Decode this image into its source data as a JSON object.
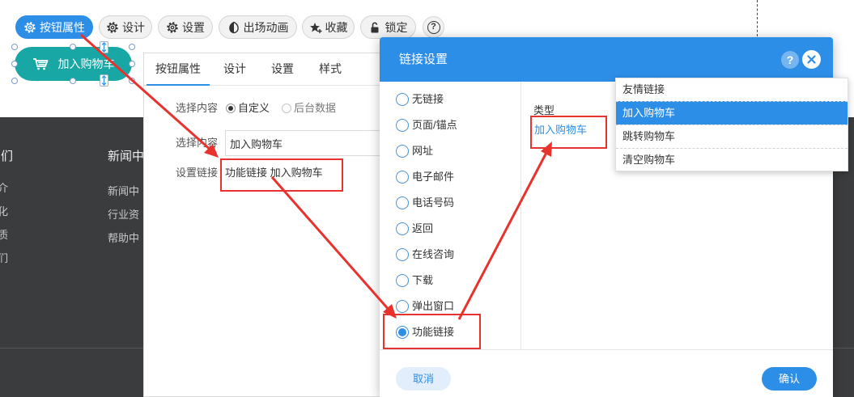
{
  "toolbar": {
    "items": [
      {
        "label": "按钮属性",
        "icon": "gear-icon",
        "active": true
      },
      {
        "label": "设计",
        "icon": "gear-icon"
      },
      {
        "label": "设置",
        "icon": "gear-icon"
      },
      {
        "label": "出场动画",
        "icon": "animation-icon"
      },
      {
        "label": "收藏",
        "icon": "star-icon"
      },
      {
        "label": "锁定",
        "icon": "lock-icon"
      }
    ],
    "help_label": "?"
  },
  "canvas": {
    "selected_button": {
      "label": "加入购物车",
      "icon": "cart-icon"
    },
    "footer": {
      "col1": {
        "heading": "们",
        "items": [
          "介",
          "化",
          "质",
          "们"
        ]
      },
      "col2": {
        "heading": "新闻中",
        "items": [
          "新闻中",
          "行业资",
          "帮助中"
        ]
      }
    }
  },
  "panel": {
    "tabs": [
      {
        "label": "按钮属性",
        "active": true
      },
      {
        "label": "设计"
      },
      {
        "label": "设置"
      },
      {
        "label": "样式"
      }
    ],
    "content_source": {
      "label": "选择内容",
      "options": [
        {
          "label": "自定义",
          "checked": true
        },
        {
          "label": "后台数据"
        }
      ]
    },
    "content": {
      "label": "选择内容",
      "value": "加入购物车"
    },
    "link": {
      "label": "设置链接",
      "value": "功能链接 加入购物车"
    }
  },
  "dialog": {
    "title": "链接设置",
    "help_label": "?",
    "close_icon": "close-icon",
    "link_types": [
      {
        "label": "无链接"
      },
      {
        "label": "页面/锚点"
      },
      {
        "label": "网址"
      },
      {
        "label": "电子邮件"
      },
      {
        "label": "电话号码"
      },
      {
        "label": "返回"
      },
      {
        "label": "在线咨询"
      },
      {
        "label": "下载"
      },
      {
        "label": "弹出窗口"
      },
      {
        "label": "功能链接",
        "checked": true
      }
    ],
    "type_label": "类型",
    "type_value": "加入购物车",
    "dropdown": {
      "options": [
        {
          "label": "友情链接"
        },
        {
          "label": "加入购物车",
          "selected": true
        },
        {
          "label": "跳转购物车"
        },
        {
          "label": "清空购物车"
        }
      ]
    },
    "cancel_label": "取消",
    "confirm_label": "确认"
  },
  "colors": {
    "accent": "#2d8ee8",
    "selected_button": "#18a7a5",
    "annotation": "#e8322d",
    "footer_bg": "#3b3c3e"
  }
}
